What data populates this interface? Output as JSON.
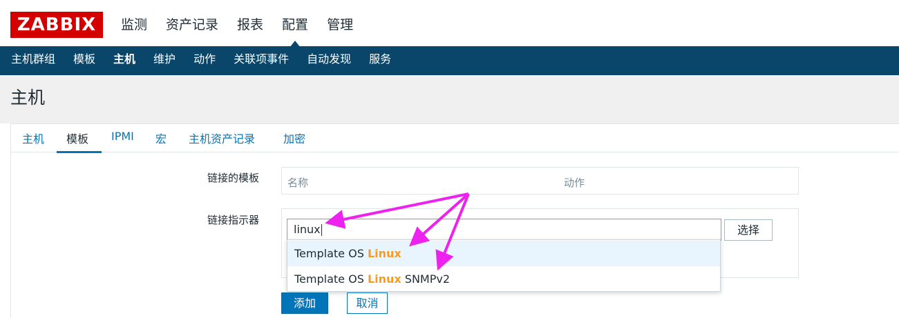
{
  "brand": {
    "logo_text": "ZABBIX",
    "accent": "#d40000",
    "nav_bg": "#0a466a"
  },
  "top_menu": [
    {
      "label": "监测"
    },
    {
      "label": "资产记录"
    },
    {
      "label": "报表"
    },
    {
      "label": "配置",
      "active": true
    },
    {
      "label": "管理"
    }
  ],
  "sub_menu": [
    {
      "label": "主机群组"
    },
    {
      "label": "模板"
    },
    {
      "label": "主机",
      "active": true
    },
    {
      "label": "维护"
    },
    {
      "label": "动作"
    },
    {
      "label": "关联项事件"
    },
    {
      "label": "自动发现"
    },
    {
      "label": "服务"
    }
  ],
  "page_title": "主机",
  "tabs": [
    {
      "label": "主机"
    },
    {
      "label": "模板",
      "active": true
    },
    {
      "label": "IPMI"
    },
    {
      "label": "宏"
    },
    {
      "label": "主机资产记录"
    },
    {
      "label": "加密"
    }
  ],
  "form": {
    "linked_templates_label": "链接的模板",
    "table_columns": {
      "name": "名称",
      "action": "动作"
    },
    "link_indicator_label": "链接指示器",
    "search_value": "linux",
    "select_button": "选择",
    "suggestions": [
      {
        "prefix": "Template OS ",
        "match": "Linux",
        "suffix": "",
        "highlighted": true
      },
      {
        "prefix": "Template OS ",
        "match": "Linux",
        "suffix": " SNMPv2",
        "highlighted": false
      }
    ],
    "add_button": "添加",
    "cancel_button": "取消"
  },
  "annotation": {
    "arrow_color": "#ee22ee"
  }
}
